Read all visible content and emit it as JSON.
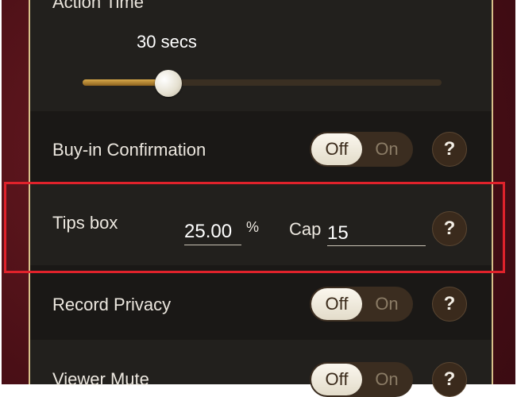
{
  "action_time": {
    "label": "Action Time",
    "value": "30 secs",
    "slider_fraction": 0.24
  },
  "buy_in": {
    "label": "Buy-in Confirmation",
    "off_label": "Off",
    "on_label": "On",
    "state": "Off",
    "help": "?"
  },
  "tips_box": {
    "label": "Tips box",
    "percent_value": "25.00",
    "percent_sign": "%",
    "cap_label": "Cap",
    "cap_value": "15",
    "help": "?"
  },
  "record_privacy": {
    "label": "Record Privacy",
    "off_label": "Off",
    "on_label": "On",
    "state": "Off",
    "help": "?"
  },
  "viewer_mute": {
    "label": "Viewer Mute",
    "off_label": "Off",
    "on_label": "On",
    "state": "Off",
    "help": "?"
  },
  "colors": {
    "highlight": "#e0222b",
    "accent_gold": "#d9a94a",
    "panel_bg": "#1c1a18"
  }
}
